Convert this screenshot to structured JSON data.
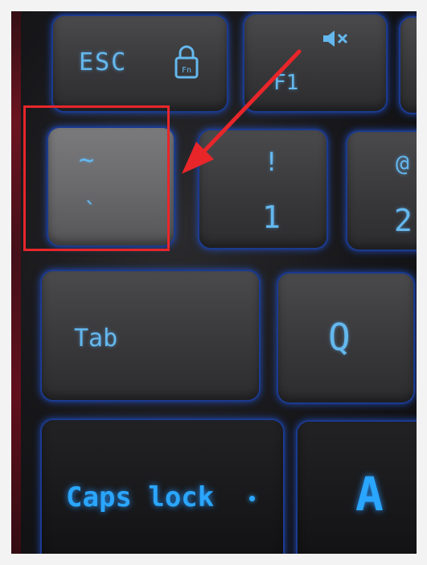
{
  "photo": {
    "keys": {
      "esc": {
        "label": "ESC"
      },
      "f1": {
        "label": "F1"
      },
      "tilde": {
        "shift": "~",
        "base": "`"
      },
      "one": {
        "shift": "!",
        "base": "1"
      },
      "two": {
        "shift": "@",
        "base": "2"
      },
      "tab": {
        "label": "Tab"
      },
      "q": {
        "label": "Q"
      },
      "capslock": {
        "label": "Caps lock"
      },
      "a": {
        "label": "A"
      }
    },
    "icons": [
      "fn-lock-icon",
      "mute-icon",
      "caps-lock-indicator-icon"
    ],
    "annotation": {
      "box_color": "#e8262a",
      "arrow_color": "#e8262a"
    },
    "backlight_color": "#2a7bff"
  }
}
